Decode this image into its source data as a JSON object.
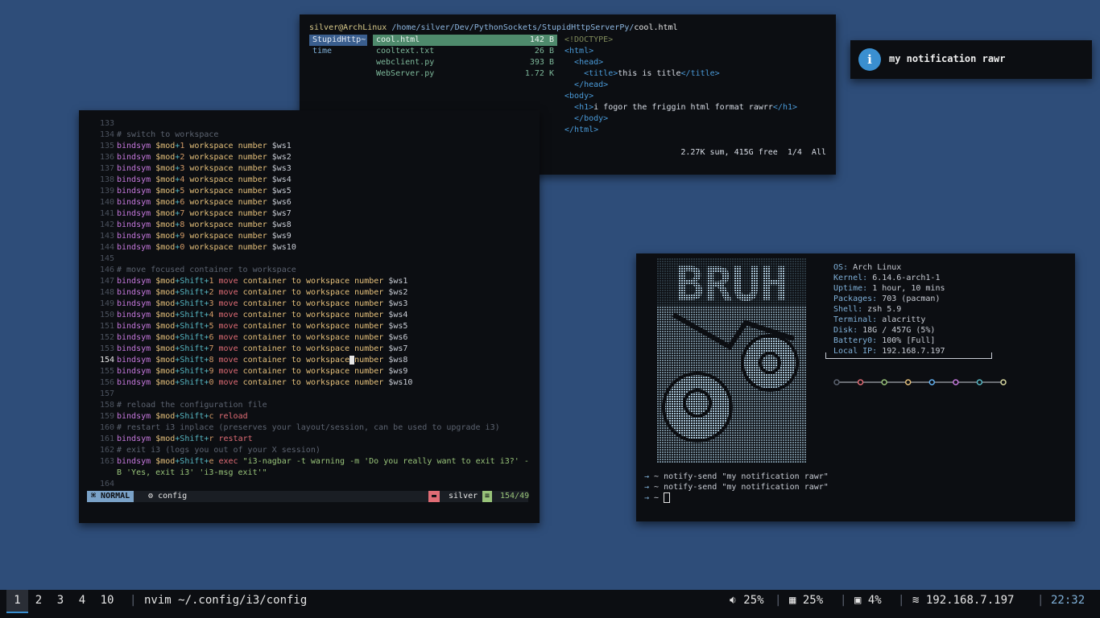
{
  "ranger": {
    "user_host": "silver@ArchLinux",
    "path": "/home/silver/Dev/PythonSockets/StupidHttpServerPy/",
    "file": "cool.html",
    "parent_dirs": [
      "StupidHttp~",
      "time"
    ],
    "files": [
      {
        "name": "cool.html",
        "size": "142 B"
      },
      {
        "name": "cooltext.txt",
        "size": "26 B"
      },
      {
        "name": "webclient.py",
        "size": "393 B"
      },
      {
        "name": "WebServer.py",
        "size": "1.72 K"
      }
    ],
    "preview": {
      "doctype": "<!DOCTYPE>",
      "html_open": "<html>",
      "head_open": "<head>",
      "title_open": "<title>",
      "title_text": "this is title",
      "title_close": "</title>",
      "head_close": "</head>",
      "body_open": "<body>",
      "h1_open": "<h1>",
      "h1_text": "i fogor the friggin html format rawrr",
      "h1_close": "</h1>",
      "body_close": "</body>",
      "html_close": "</html>"
    },
    "status": "2.27K sum, 415G free  1/4  All"
  },
  "nvim": {
    "lines": [
      {
        "n": "133",
        "t": ""
      },
      {
        "n": "134",
        "c": "# switch to workspace"
      },
      {
        "n": "135",
        "k": "1",
        "ws": "$ws1"
      },
      {
        "n": "136",
        "k": "2",
        "ws": "$ws2"
      },
      {
        "n": "137",
        "k": "3",
        "ws": "$ws3"
      },
      {
        "n": "138",
        "k": "4",
        "ws": "$ws4"
      },
      {
        "n": "139",
        "k": "5",
        "ws": "$ws5"
      },
      {
        "n": "140",
        "k": "6",
        "ws": "$ws6"
      },
      {
        "n": "141",
        "k": "7",
        "ws": "$ws7"
      },
      {
        "n": "142",
        "k": "8",
        "ws": "$ws8"
      },
      {
        "n": "143",
        "k": "9",
        "ws": "$ws9"
      },
      {
        "n": "144",
        "k": "0",
        "ws": "$ws10"
      },
      {
        "n": "145",
        "t": ""
      },
      {
        "n": "146",
        "c": "# move focused container to workspace"
      },
      {
        "n": "147",
        "k": "1",
        "ws": "$ws1",
        "move": true
      },
      {
        "n": "148",
        "k": "2",
        "ws": "$ws2",
        "move": true
      },
      {
        "n": "149",
        "k": "3",
        "ws": "$ws3",
        "move": true
      },
      {
        "n": "150",
        "k": "4",
        "ws": "$ws4",
        "move": true
      },
      {
        "n": "151",
        "k": "5",
        "ws": "$ws5",
        "move": true
      },
      {
        "n": "152",
        "k": "6",
        "ws": "$ws6",
        "move": true
      },
      {
        "n": "153",
        "k": "7",
        "ws": "$ws7",
        "move": true
      },
      {
        "n": "154",
        "k": "8",
        "ws": "$ws8",
        "move": true,
        "cur": true
      },
      {
        "n": "155",
        "k": "9",
        "ws": "$ws9",
        "move": true
      },
      {
        "n": "156",
        "k": "0",
        "ws": "$ws10",
        "move": true
      },
      {
        "n": "157",
        "t": ""
      },
      {
        "n": "158",
        "c": "# reload the configuration file"
      },
      {
        "n": "159",
        "sk": "c",
        "cmd": "reload"
      },
      {
        "n": "160",
        "c": "# restart i3 inplace (preserves your layout/session, can be used to upgrade i3)"
      },
      {
        "n": "161",
        "sk": "r",
        "cmd": "restart"
      },
      {
        "n": "162",
        "c": "# exit i3 (logs you out of your X session)"
      },
      {
        "n": "163",
        "sk": "e",
        "cmd": "exec",
        "str": "\"i3-nagbar -t warning -m 'Do you really want to exit i3?' -"
      },
      {
        "n": "",
        "str": "B 'Yes, exit i3' 'i3-msg exit'\""
      },
      {
        "n": "164",
        "t": ""
      }
    ],
    "tokens": {
      "bindsym": "bindsym",
      "mod": "$mod",
      "plus": "+",
      "shift": "Shift",
      "workspace": "workspace",
      "number": "number",
      "move": "move",
      "container": "container",
      "to": "to"
    },
    "status": {
      "mode": "NORMAL",
      "file": "config",
      "user": "silver",
      "pos": "154/49"
    }
  },
  "notification": {
    "icon": "i",
    "text": "my notification rawr"
  },
  "fetch": {
    "ascii_word": "BRUH",
    "info": [
      {
        "k": "OS:",
        "v": "Arch Linux"
      },
      {
        "k": "Kernel:",
        "v": "6.14.6-arch1-1"
      },
      {
        "k": "Uptime:",
        "v": "1 hour, 10 mins"
      },
      {
        "k": "Packages:",
        "v": "703 (pacman)"
      },
      {
        "k": "Shell:",
        "v": "zsh 5.9"
      },
      {
        "k": "Terminal:",
        "v": "alacritty"
      },
      {
        "k": "Disk:",
        "v": "18G / 457G (5%)"
      },
      {
        "k": "Battery0:",
        "v": "100% [Full]"
      },
      {
        "k": "Local IP:",
        "v": "192.168.7.197"
      }
    ],
    "palette": [
      "#5c6370",
      "#e06c75",
      "#98c379",
      "#e5c07b",
      "#61afef",
      "#c678dd",
      "#56b6c2",
      "#d8d8a0"
    ],
    "prompts": [
      {
        "arrow": "→",
        "text": " ~ notify-send \"my notification rawr\""
      },
      {
        "arrow": "→",
        "text": " ~ notify-send \"my notification rawr\""
      },
      {
        "arrow": "→",
        "text": " ~ "
      }
    ]
  },
  "bar": {
    "workspaces": [
      "1",
      "2",
      "3",
      "4",
      "10"
    ],
    "title": "nvim ~/.config/i3/config",
    "volume": "25%",
    "memory": "25%",
    "cpu": "4%",
    "ip": "192.168.7.197",
    "time": "22:32"
  }
}
